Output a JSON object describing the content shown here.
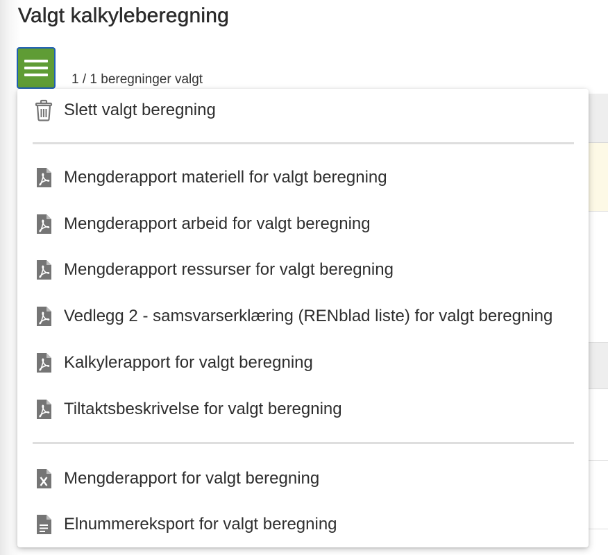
{
  "page": {
    "title": "Valgt kalkyleberegning",
    "selection_count": "1 / 1 beregninger valgt"
  },
  "menu": {
    "groups": [
      [
        {
          "label": "Slett valgt beregning",
          "icon": "trash-icon"
        }
      ],
      [
        {
          "label": "Mengderapport materiell for valgt beregning",
          "icon": "pdf-file-icon"
        },
        {
          "label": "Mengderapport arbeid for valgt beregning",
          "icon": "pdf-file-icon"
        },
        {
          "label": "Mengderapport ressurser for valgt beregning",
          "icon": "pdf-file-icon"
        },
        {
          "label": "Vedlegg 2 - samsvarserklæring (RENblad liste) for valgt beregning",
          "icon": "pdf-file-icon"
        },
        {
          "label": "Kalkylerapport for valgt beregning",
          "icon": "pdf-file-icon"
        },
        {
          "label": "Tiltaktsbeskrivelse for valgt beregning",
          "icon": "pdf-file-icon"
        }
      ],
      [
        {
          "label": "Mengderapport for valgt beregning",
          "icon": "excel-file-icon"
        },
        {
          "label": "Elnummereksport for valgt beregning",
          "icon": "text-file-icon"
        }
      ]
    ]
  },
  "colors": {
    "menu_button": "#5f9c35",
    "menu_button_border": "#1f5fb3",
    "icon": "#757575",
    "text": "#2e2e2e"
  }
}
